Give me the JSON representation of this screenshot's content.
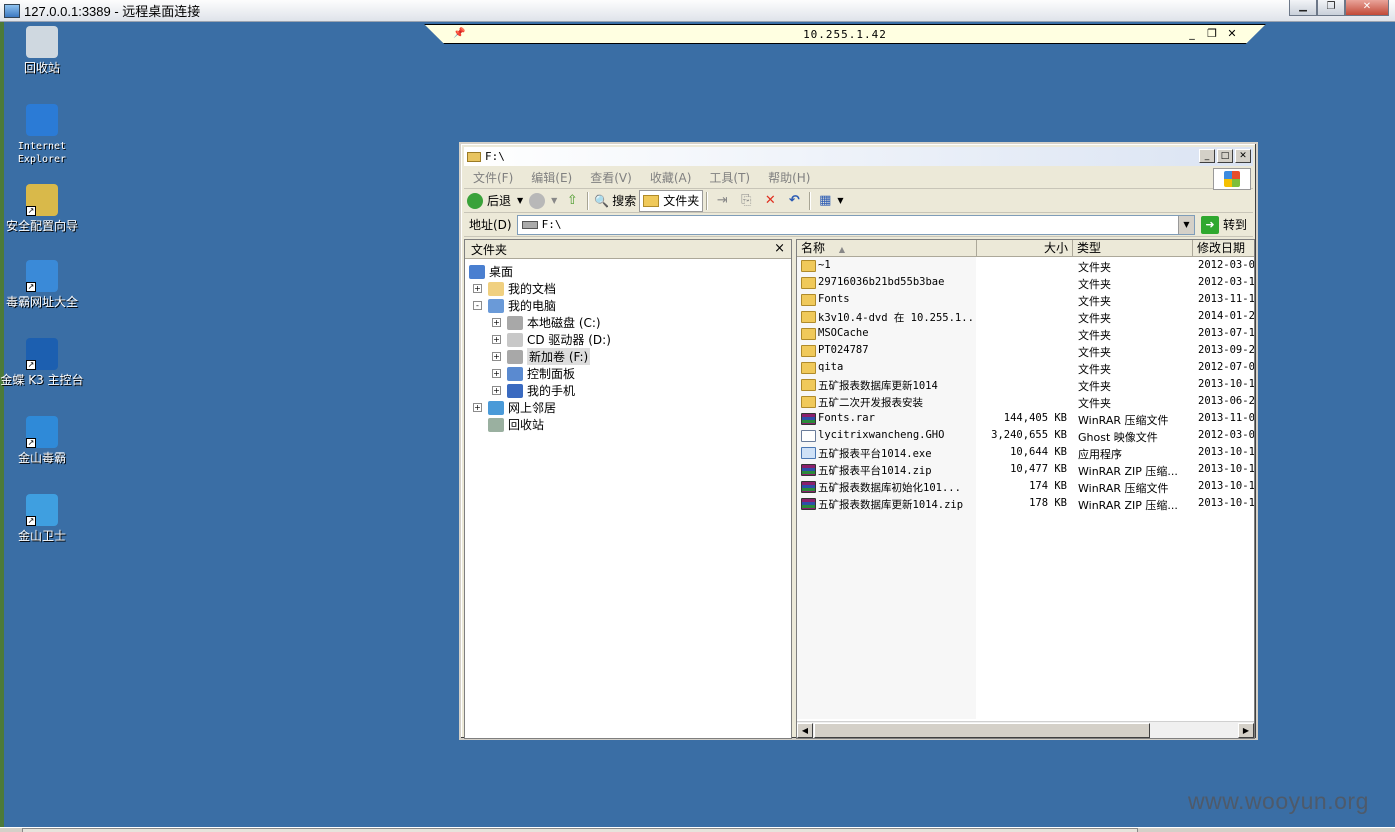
{
  "rdp": {
    "title": "127.0.0.1:3389 - 远程桌面连接"
  },
  "connection_bar": {
    "host": "10.255.1.42",
    "minimize": "_",
    "restore": "❐",
    "close": "✕"
  },
  "desktop_icons": [
    {
      "label": "回收站",
      "icon": "recycle-bin-icon"
    },
    {
      "label": "Internet\nExplorer",
      "icon": "internet-explorer-icon"
    },
    {
      "label": "安全配置向导",
      "icon": "security-wizard-icon"
    },
    {
      "label": "毒霸网址大全",
      "icon": "browser-shortcut-icon"
    },
    {
      "label": "金蝶 K3 主控台",
      "icon": "kingdee-k3-icon"
    },
    {
      "label": "金山毒霸",
      "icon": "kingsoft-antivirus-icon"
    },
    {
      "label": "金山卫士",
      "icon": "kingsoft-guard-icon"
    }
  ],
  "explorer": {
    "title": "F:\\",
    "menu": [
      "文件(F)",
      "编辑(E)",
      "查看(V)",
      "收藏(A)",
      "工具(T)",
      "帮助(H)"
    ],
    "toolbar": {
      "back": "后退",
      "search": "搜索",
      "folders": "文件夹"
    },
    "address": {
      "label": "地址(D)",
      "value": "F:\\",
      "go": "转到"
    },
    "folders_pane": {
      "title": "文件夹",
      "close": "×",
      "tree": [
        {
          "label": "桌面",
          "level": 0,
          "expander": "",
          "icon": "desktop-icon"
        },
        {
          "label": "我的文档",
          "level": 1,
          "expander": "+",
          "icon": "my-documents-icon"
        },
        {
          "label": "我的电脑",
          "level": 1,
          "expander": "-",
          "icon": "my-computer-icon"
        },
        {
          "label": "本地磁盘 (C:)",
          "level": 2,
          "expander": "+",
          "icon": "hard-disk-icon"
        },
        {
          "label": "CD 驱动器 (D:)",
          "level": 2,
          "expander": "+",
          "icon": "cd-drive-icon"
        },
        {
          "label": "新加卷 (F:)",
          "level": 2,
          "expander": "+",
          "icon": "hard-disk-icon",
          "selected": true
        },
        {
          "label": "控制面板",
          "level": 2,
          "expander": "+",
          "icon": "control-panel-icon"
        },
        {
          "label": "我的手机",
          "level": 2,
          "expander": "+",
          "icon": "phone-icon"
        },
        {
          "label": "网上邻居",
          "level": 1,
          "expander": "+",
          "icon": "network-icon"
        },
        {
          "label": "回收站",
          "level": 1,
          "expander": "",
          "icon": "recycle-bin-icon"
        }
      ]
    },
    "files_pane": {
      "columns": [
        "名称",
        "大小",
        "类型",
        "修改日期"
      ],
      "sort_indicator": "▲",
      "rows": [
        {
          "name": "~1",
          "size": "",
          "type": "文件夹",
          "date": "2012-03-0",
          "kind": "folder"
        },
        {
          "name": "29716036b21bd55b3bae",
          "size": "",
          "type": "文件夹",
          "date": "2012-03-1",
          "kind": "folder"
        },
        {
          "name": "Fonts",
          "size": "",
          "type": "文件夹",
          "date": "2013-11-1",
          "kind": "folder"
        },
        {
          "name": "k3v10.4-dvd 在 10.255.1...",
          "size": "",
          "type": "文件夹",
          "date": "2014-01-2",
          "kind": "folder"
        },
        {
          "name": "MSOCache",
          "size": "",
          "type": "文件夹",
          "date": "2013-07-1",
          "kind": "folder"
        },
        {
          "name": "PT024787",
          "size": "",
          "type": "文件夹",
          "date": "2013-09-2",
          "kind": "folder"
        },
        {
          "name": "qita",
          "size": "",
          "type": "文件夹",
          "date": "2012-07-0",
          "kind": "folder"
        },
        {
          "name": "五矿报表数据库更新1014",
          "size": "",
          "type": "文件夹",
          "date": "2013-10-1",
          "kind": "folder"
        },
        {
          "name": "五矿二次开发报表安装",
          "size": "",
          "type": "文件夹",
          "date": "2013-06-2",
          "kind": "folder"
        },
        {
          "name": "Fonts.rar",
          "size": "144,405 KB",
          "type": "WinRAR 压缩文件",
          "date": "2013-11-0",
          "kind": "rar"
        },
        {
          "name": "lycitrixwancheng.GHO",
          "size": "3,240,655 KB",
          "type": "Ghost 映像文件",
          "date": "2012-03-0",
          "kind": "ghost"
        },
        {
          "name": "五矿报表平台1014.exe",
          "size": "10,644 KB",
          "type": "应用程序",
          "date": "2013-10-1",
          "kind": "exe"
        },
        {
          "name": "五矿报表平台1014.zip",
          "size": "10,477 KB",
          "type": "WinRAR ZIP 压缩...",
          "date": "2013-10-1",
          "kind": "rar"
        },
        {
          "name": "五矿报表数据库初始化101...",
          "size": "174 KB",
          "type": "WinRAR 压缩文件",
          "date": "2013-10-1",
          "kind": "rar"
        },
        {
          "name": "五矿报表数据库更新1014.zip",
          "size": "178 KB",
          "type": "WinRAR ZIP 压缩...",
          "date": "2013-10-1",
          "kind": "rar"
        }
      ]
    }
  },
  "watermark": "www.wooyun.org"
}
